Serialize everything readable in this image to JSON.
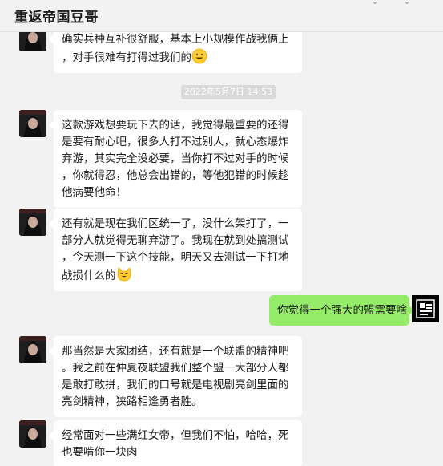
{
  "header": {
    "title": "重返帝国豆哥"
  },
  "timestamp": "2022年5月7日 14:53",
  "messages": [
    {
      "side": "left",
      "lines": [
        "确实兵种互补很舒服，基本上小规模作战我俩上",
        "，对手很难有打得过我们的"
      ],
      "emoji": "grinning-face-emoji"
    },
    {
      "side": "left",
      "lines": [
        "这款游戏想要玩下去的话，我觉得最重要的还得",
        "是要有耐心吧，很多人打不过别人，就心态爆炸",
        "弃游，其实完全没必要，当你打不过对手的时候",
        "，你就得忍，他总会出错的，等他犯错的时候趁",
        "他病要他命！"
      ]
    },
    {
      "side": "left",
      "lines": [
        "还有就是现在我们区统一了，没什么架打了，一",
        "部分人就觉得无聊弃游了。我现在就到处搞测试",
        "，今天测一下这个技能，明天又去测试一下打地",
        "战损什么的"
      ],
      "emoji": "cat-face-emoji"
    },
    {
      "side": "right",
      "lines": [
        "你觉得一个强大的盟需要啥"
      ]
    },
    {
      "side": "left",
      "lines": [
        "那当然是大家团结，还有就是一个联盟的精神吧",
        "。我之前在仲夏夜联盟我们整个盟一大部分人都",
        "是敢打敢拼，我们的口号就是电视剧亮剑里面的",
        "亮剑精神，狭路相逢勇者胜。"
      ]
    },
    {
      "side": "left",
      "lines": [
        "经常面对一些满红女帝，但我们不怕，哈哈，死",
        "也要啃你一块肉"
      ]
    }
  ]
}
